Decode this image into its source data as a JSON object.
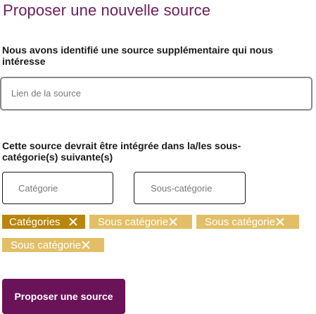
{
  "page": {
    "title": "Proposer une nouvelle source"
  },
  "source_section": {
    "label": "Nous avons identifié une source supplémentaire qui nous intéresse",
    "placeholder": "Lien de la source"
  },
  "category_section": {
    "label": "Cette source devrait être intégrée dans la/les sous-catégorie(s) suivante(s)",
    "category_placeholder": "Catégorie",
    "subcategory_placeholder": "Sous-catégorie"
  },
  "chips": [
    {
      "label": "Catégories",
      "remove_icon": "close-icon",
      "color": "#b8860b"
    },
    {
      "label": "Sous catégorie",
      "remove_icon": "close-icon",
      "color": "#e2bf67"
    },
    {
      "label": "Sous catégorie",
      "remove_icon": "close-icon",
      "color": "#e2bf67"
    },
    {
      "label": "Sous catégorie",
      "remove_icon": "close-icon",
      "color": "#e2bf67"
    }
  ],
  "submit": {
    "label": "Proposer une source",
    "color": "#6b1358"
  },
  "colors": {
    "title": "#6b1d5a",
    "text": "#1a1a1a",
    "placeholder": "#7a7a7a"
  }
}
